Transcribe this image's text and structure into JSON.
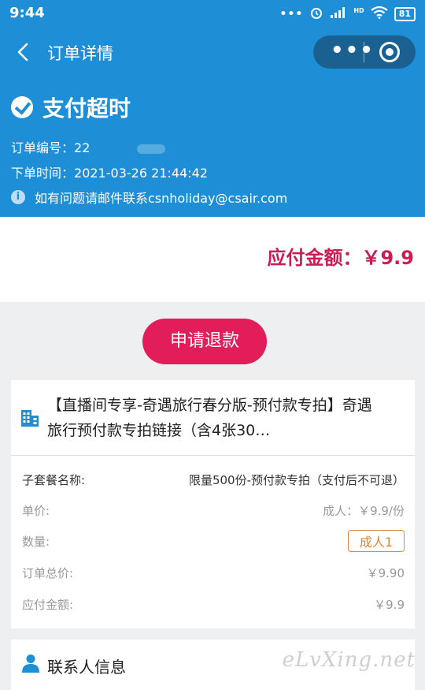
{
  "status_bar": {
    "time": "9:44",
    "signal_dots": "•••",
    "network_label": "HD",
    "battery": "81"
  },
  "nav": {
    "title": "订单详情",
    "more_label": "•••"
  },
  "order": {
    "status": "支付超时",
    "order_number_label": "订单编号：",
    "order_number": "22",
    "order_time_label": "下单时间：",
    "order_time": "2021-03-26 21:44:42",
    "contact_notice": "如有问题请邮件联系csnholiday@csair.com"
  },
  "amount_due": "应付金额：￥9.9",
  "refund_button": "申请退款",
  "product": {
    "title": "【直播间专享-奇遇旅行春分版-预付款专拍】奇遇旅行预付款专拍链接（含4张30…",
    "rows": [
      {
        "label": "子套餐名称:",
        "value": "限量500份-预付款专拍（支付后不可退）"
      },
      {
        "label": "单价:",
        "value": "成人：￥9.9/份"
      },
      {
        "label": "数量:",
        "value": "成人1"
      },
      {
        "label": "订单总价:",
        "value": "￥9.90"
      },
      {
        "label": "应付金额:",
        "value": "￥9.9"
      }
    ]
  },
  "contact_section": {
    "title": "联系人信息"
  },
  "watermark": "eLvXing.net",
  "colors": {
    "header_blue": "#1e8fd6",
    "accent_red": "#e31c5a",
    "amount_red": "#cc1b55",
    "tag_orange": "#e0863c"
  }
}
